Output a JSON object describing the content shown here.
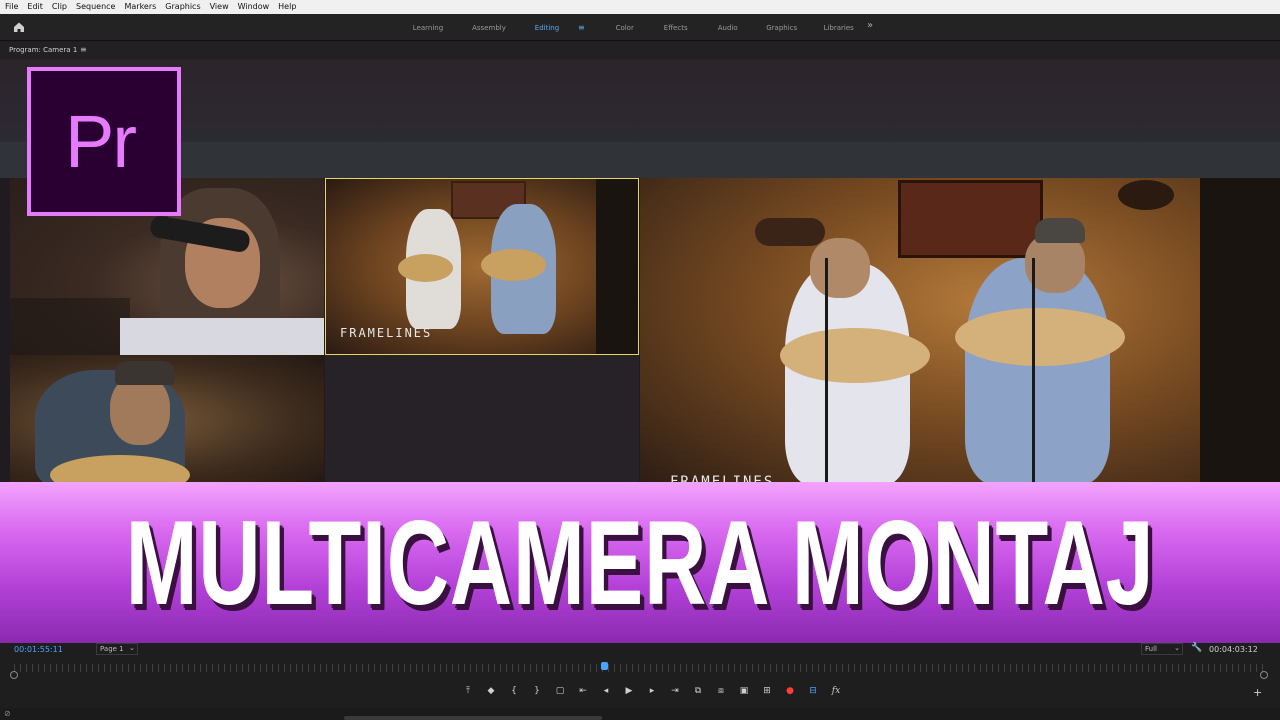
{
  "menu": [
    "File",
    "Edit",
    "Clip",
    "Sequence",
    "Markers",
    "Graphics",
    "View",
    "Window",
    "Help"
  ],
  "workspaces": [
    {
      "label": "Learning",
      "active": false
    },
    {
      "label": "Assembly",
      "active": false
    },
    {
      "label": "Editing",
      "active": true
    },
    {
      "label": "Color",
      "active": false
    },
    {
      "label": "Effects",
      "active": false
    },
    {
      "label": "Audio",
      "active": false
    },
    {
      "label": "Graphics",
      "active": false
    },
    {
      "label": "Libraries",
      "active": false
    }
  ],
  "workspace_menu_icon": "hamburger-icon",
  "more_label": "»",
  "panel": {
    "title": "Program: Camera 1",
    "menu_glyph": "≡"
  },
  "logo": {
    "text": "Pr",
    "color": "#e77bff",
    "bg": "#2a0032"
  },
  "watermark": {
    "cam2": "FRAMELINES",
    "main": "FRAMELINES"
  },
  "banner": {
    "text": "MULTICAMERA MONTAJ"
  },
  "controls": {
    "timecode_current": "00:01:55:11",
    "page_select": "Page 1",
    "zoom_select": "Full",
    "timecode_duration": "00:04:03:12",
    "buttons": [
      {
        "name": "lift-icon",
        "glyph": "⤒"
      },
      {
        "name": "marker-icon",
        "glyph": "◆"
      },
      {
        "name": "mark-in-icon",
        "glyph": "{"
      },
      {
        "name": "mark-out-icon",
        "glyph": "}"
      },
      {
        "name": "safe-margins-icon",
        "glyph": "▢"
      },
      {
        "name": "go-to-in-icon",
        "glyph": "⇤"
      },
      {
        "name": "step-back-icon",
        "glyph": "◂"
      },
      {
        "name": "play-icon",
        "glyph": "▶"
      },
      {
        "name": "step-forward-icon",
        "glyph": "▸"
      },
      {
        "name": "go-to-out-icon",
        "glyph": "⇥"
      },
      {
        "name": "insert-icon",
        "glyph": "⧉"
      },
      {
        "name": "overwrite-icon",
        "glyph": "⧈"
      },
      {
        "name": "export-frame-icon",
        "glyph": "▣"
      },
      {
        "name": "button-editor-icon",
        "glyph": "⊞"
      },
      {
        "name": "record-icon",
        "glyph": "●"
      },
      {
        "name": "vr-video-icon",
        "glyph": "⊟"
      },
      {
        "name": "fx-icon",
        "glyph": "fx"
      }
    ],
    "add_button": "+"
  },
  "accent": "#4aa3ff"
}
